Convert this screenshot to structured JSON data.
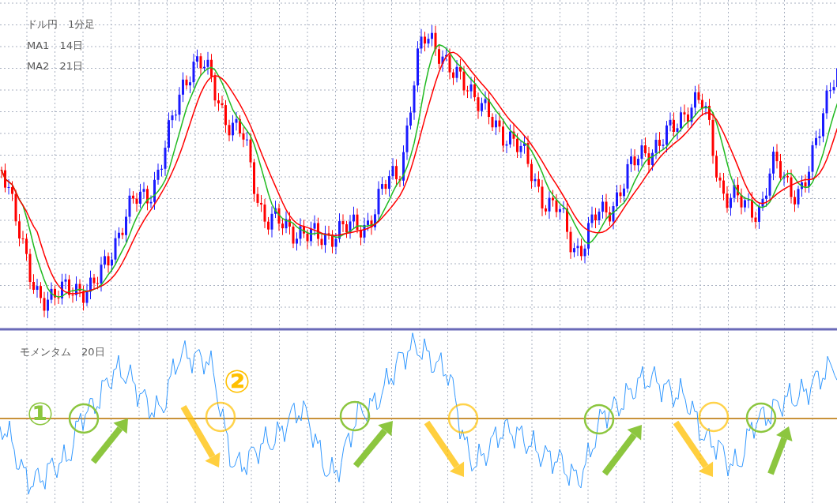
{
  "price_panel": {
    "title": "ドル円　1分足",
    "ma_labels": [
      "MA1　14日",
      "MA2　21日"
    ]
  },
  "momentum_panel": {
    "title": "モメンタム　20日"
  },
  "markers": [
    {
      "label": "①",
      "color": "#8cc63f"
    },
    {
      "label": "②",
      "color": "#ffc000"
    }
  ]
}
